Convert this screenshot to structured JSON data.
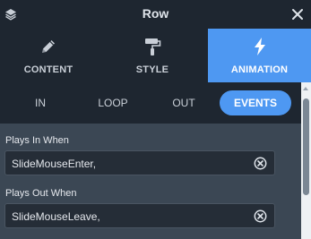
{
  "window": {
    "title": "Row",
    "leading_icon": "layers-icon",
    "close_icon": "close-icon"
  },
  "main_tabs": [
    {
      "label": "CONTENT",
      "icon": "pencil-icon",
      "active": false
    },
    {
      "label": "STYLE",
      "icon": "paint-roller-icon",
      "active": false
    },
    {
      "label": "ANIMATION",
      "icon": "lightning-bolt-icon",
      "active": true
    }
  ],
  "sub_tabs": [
    {
      "label": "IN",
      "active": false
    },
    {
      "label": "LOOP",
      "active": false
    },
    {
      "label": "OUT",
      "active": false
    },
    {
      "label": "EVENTS",
      "active": true
    }
  ],
  "events": {
    "plays_in": {
      "label": "Plays In When",
      "value": "SlideMouseEnter,",
      "clear_icon": "clear-circle-icon"
    },
    "plays_out": {
      "label": "Plays Out When",
      "value": "SlideMouseLeave,",
      "clear_icon": "clear-circle-icon"
    }
  },
  "colors": {
    "header_bg": "#1e2630",
    "panel_bg": "#3b4754",
    "accent": "#4e98f2",
    "field_bg": "#252d37"
  }
}
